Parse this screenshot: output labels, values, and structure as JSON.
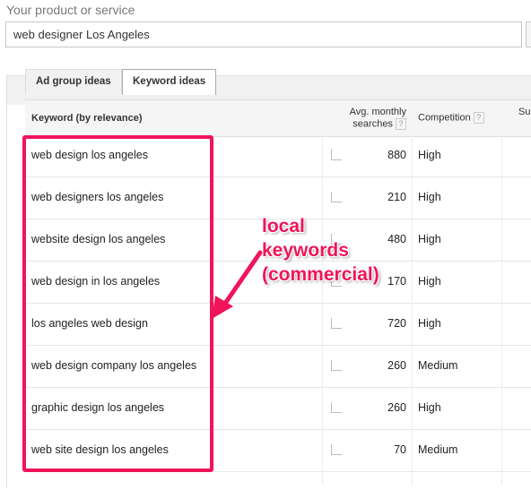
{
  "search": {
    "label": "Your product or service",
    "value": "web designer Los Angeles"
  },
  "tabs": [
    {
      "label": "Ad group ideas",
      "active": false
    },
    {
      "label": "Keyword ideas",
      "active": true
    }
  ],
  "table": {
    "headers": {
      "keyword": "Keyword (by relevance)",
      "searches_1": "Avg. monthly",
      "searches_2": "searches",
      "competition": "Competition",
      "help": "?",
      "bid": "Su"
    },
    "rows": [
      {
        "keyword": "web design los angeles",
        "searches": "880",
        "competition": "High"
      },
      {
        "keyword": "web designers los angeles",
        "searches": "210",
        "competition": "High"
      },
      {
        "keyword": "website design los angeles",
        "searches": "480",
        "competition": "High"
      },
      {
        "keyword": "web design in los angeles",
        "searches": "170",
        "competition": "High"
      },
      {
        "keyword": "los angeles web design",
        "searches": "720",
        "competition": "High"
      },
      {
        "keyword": "web design company los angeles",
        "searches": "260",
        "competition": "Medium"
      },
      {
        "keyword": "graphic design los angeles",
        "searches": "260",
        "competition": "High"
      },
      {
        "keyword": "web site design los angeles",
        "searches": "70",
        "competition": "Medium"
      }
    ]
  },
  "annotation": {
    "line1": "local",
    "line2": "keywords",
    "line3": "(commercial)",
    "color": "#f0145a"
  }
}
